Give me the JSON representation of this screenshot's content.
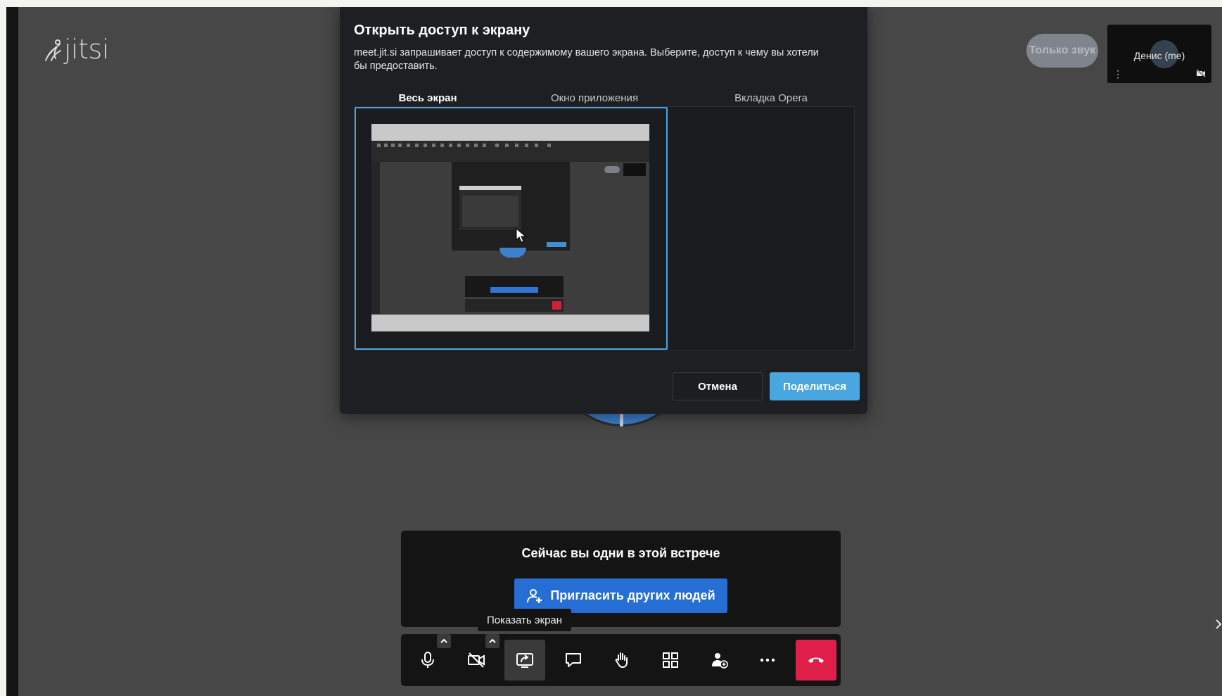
{
  "app": {
    "logo_text": "jitsi"
  },
  "participants": {
    "audio_only_label": "Только звук",
    "self_name": "Денис (me)"
  },
  "share_dialog": {
    "title": "Открыть доступ к экрану",
    "description": "meet.jit.si запрашивает доступ к содержимому вашего экрана. Выберите, доступ к чему вы хотели бы предоставить.",
    "tabs": [
      {
        "label": "Весь экран",
        "active": true
      },
      {
        "label": "Окно приложения",
        "active": false
      },
      {
        "label": "Вкладка Opera",
        "active": false
      }
    ],
    "cancel_label": "Отмена",
    "share_label": "Поделиться"
  },
  "alone_panel": {
    "message": "Сейчас вы одни в этой встрече",
    "invite_label": "Пригласить других людей"
  },
  "tooltip": {
    "text": "Показать экран"
  },
  "toolbar": {
    "buttons": [
      {
        "icon": "microphone-icon",
        "caret": true
      },
      {
        "icon": "camera-off-icon",
        "caret": true
      },
      {
        "icon": "screen-share-icon",
        "active": true
      },
      {
        "icon": "chat-icon"
      },
      {
        "icon": "raise-hand-icon"
      },
      {
        "icon": "tile-view-icon"
      },
      {
        "icon": "invite-participant-icon"
      },
      {
        "icon": "more-options-icon"
      },
      {
        "icon": "hangup-icon"
      }
    ],
    "hangup_color": "#dd1f4a"
  },
  "colors": {
    "accent": "#4aa6df",
    "invite_blue": "#256ed3",
    "background": "#474747"
  }
}
